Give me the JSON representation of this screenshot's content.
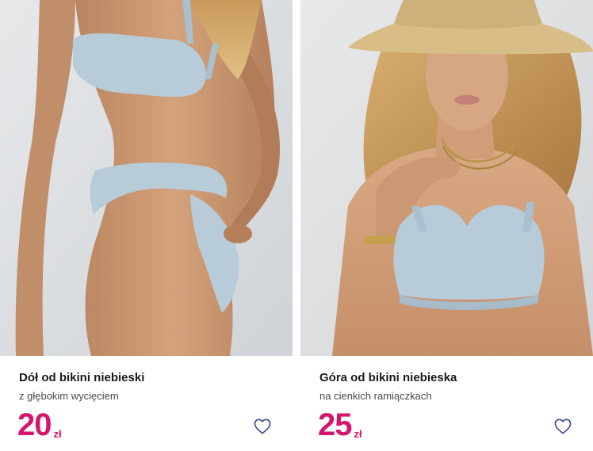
{
  "products": [
    {
      "title": "Dół od bikini niebieski",
      "subtitle": "z głębokim wycięciem",
      "price": "20",
      "currency": "zł",
      "image_alt": "model-back-bikini-bottom"
    },
    {
      "title": "Góra od bikini niebieska",
      "subtitle": "na cienkich ramiączkach",
      "price": "25",
      "currency": "zł",
      "image_alt": "model-hat-bikini-top"
    }
  ],
  "colors": {
    "price": "#d6166e",
    "wishlist_icon": "#3b4a8c",
    "swimwear": "#b7cbd8"
  },
  "icons": {
    "wishlist": "heart-outline-icon"
  }
}
